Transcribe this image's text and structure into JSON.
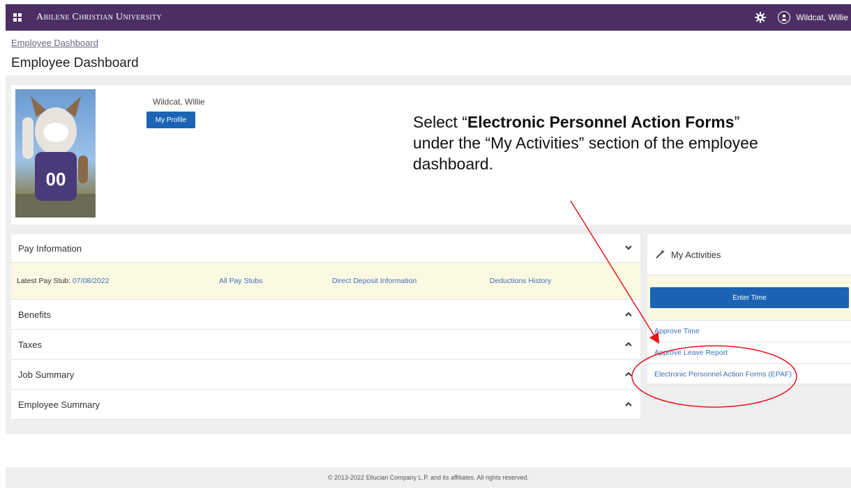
{
  "header": {
    "brand": "Abilene Christian University",
    "user_name": "Wildcat, Willie",
    "icons": [
      "apps-grid-icon",
      "gear-icon",
      "user-icon"
    ],
    "color": "#4b2e63"
  },
  "breadcrumb": "Employee Dashboard",
  "page_title": "Employee Dashboard",
  "profile": {
    "name": "Wildcat, Willie",
    "button_label": "My Profile"
  },
  "instruction": {
    "prefix": "Select “",
    "bold": "Electronic Personnel Action Forms",
    "suffix": "” under the “My Activities” section of the employee dashboard."
  },
  "pay_information": {
    "title": "Pay Information",
    "latest_label": "Latest Pay Stub: ",
    "latest_date": "07/08/2022",
    "links": [
      "All Pay Stubs",
      "Direct Deposit Information",
      "Deductions History"
    ]
  },
  "sections": [
    "Benefits",
    "Taxes",
    "Job Summary",
    "Employee Summary"
  ],
  "activities": {
    "title": "My Activities",
    "enter_time": "Enter Time",
    "links": [
      "Approve Time",
      "Approve Leave Report",
      "Electronic Personnel Action Forms (EPAF)"
    ]
  },
  "footer": "© 2013-2022 Ellucian Company L.P. and its affiliates. All rights reserved.",
  "colors": {
    "primary_button": "#1a63b5",
    "link": "#3c6fb5",
    "highlight_row": "#fcf9e3",
    "annotation": "#e8141c"
  }
}
